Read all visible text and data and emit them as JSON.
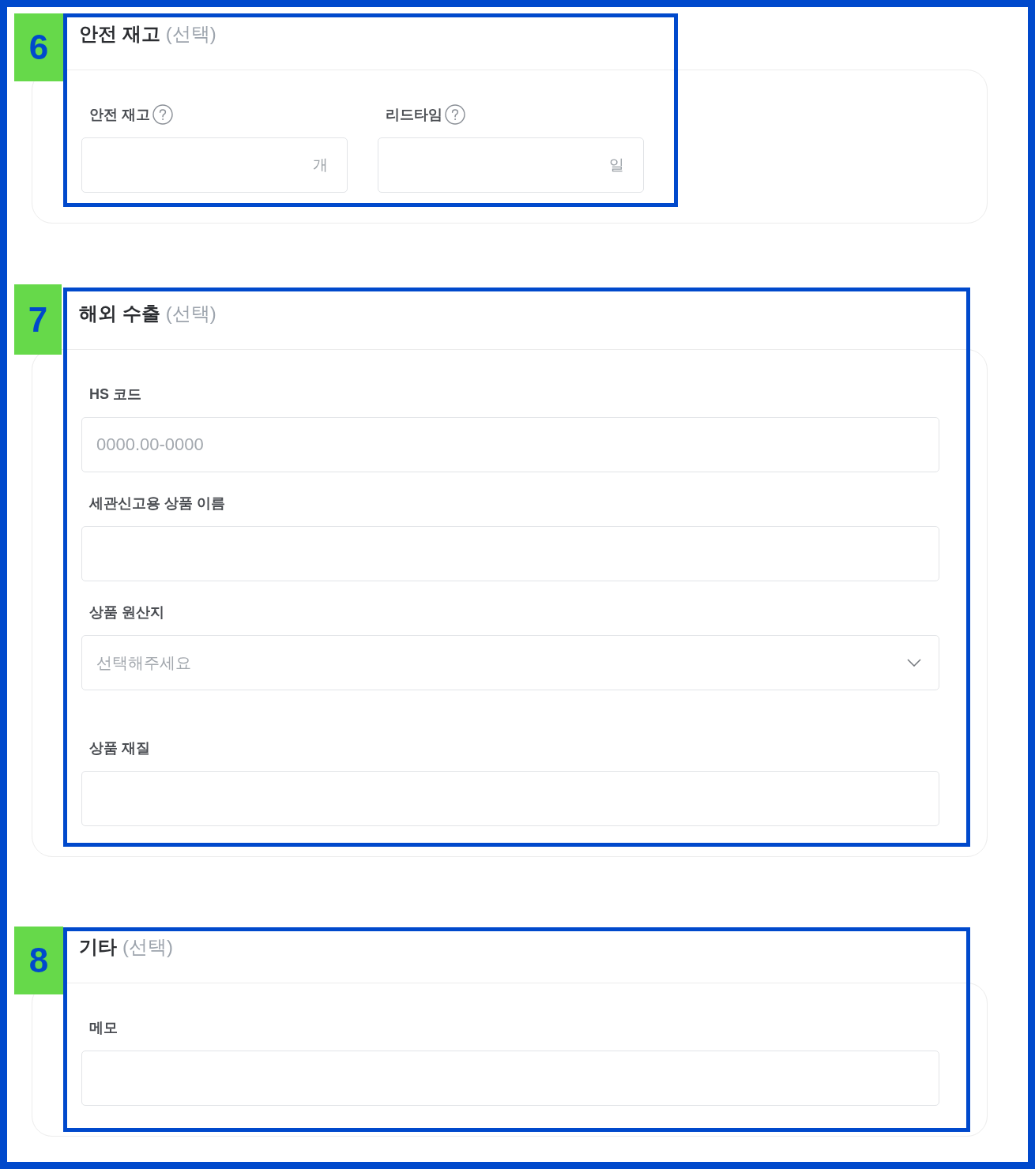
{
  "sections": [
    {
      "badge": "6",
      "title": "안전 재고",
      "optional": "(선택)",
      "kind": "row",
      "fields": [
        {
          "kind": "input",
          "label": "안전 재고",
          "help": true,
          "suffix": "개"
        },
        {
          "kind": "input",
          "label": "리드타임",
          "help": true,
          "suffix": "일"
        }
      ]
    },
    {
      "badge": "7",
      "title": "해외 수출",
      "optional": "(선택)",
      "kind": "stack",
      "fields": [
        {
          "kind": "input",
          "label": "HS 코드",
          "help": false,
          "placeholder": "0000.00-0000"
        },
        {
          "kind": "input",
          "label": "세관신고용 상품 이름",
          "help": false
        },
        {
          "kind": "select",
          "label": "상품 원산지",
          "help": false,
          "placeholder": "선택해주세요"
        },
        {
          "kind": "input",
          "label": "상품 재질",
          "help": false
        }
      ]
    },
    {
      "badge": "8",
      "title": "기타",
      "optional": "(선택)",
      "kind": "stack",
      "fields": [
        {
          "kind": "input",
          "label": "메모",
          "help": false
        }
      ]
    }
  ]
}
